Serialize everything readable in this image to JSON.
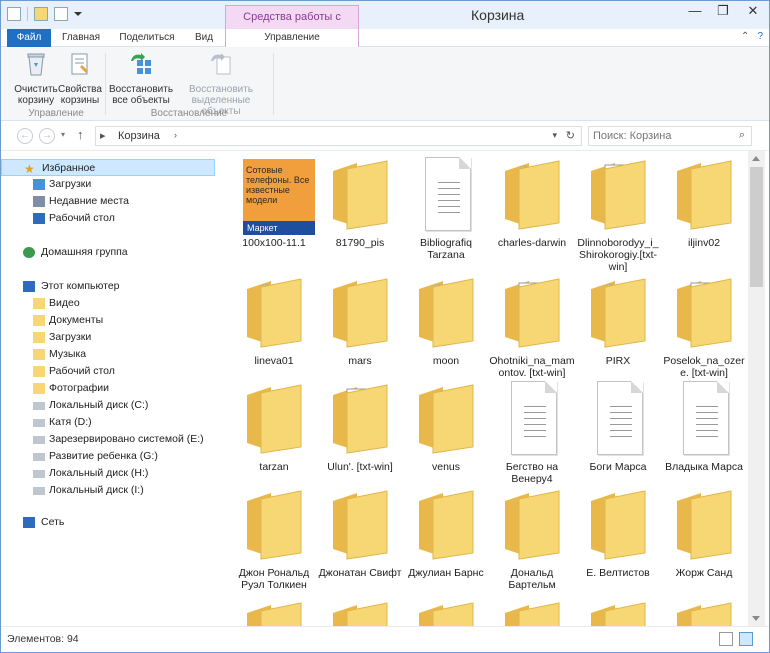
{
  "window": {
    "title": "Корзина",
    "context_tab_group": "Средства работы с корзиной",
    "controls": {
      "minimize": "—",
      "maximize": "❐",
      "close": "✕"
    }
  },
  "tabs": {
    "file": "Файл",
    "home": "Главная",
    "share": "Поделиться",
    "view": "Вид",
    "manage": "Управление"
  },
  "ribbon": {
    "empty_bin": "Очистить корзину",
    "bin_props": "Свойства корзины",
    "group_manage": "Управление",
    "restore_all": "Восстановить все объекты",
    "restore_selected": "Восстановить выделенные объекты",
    "group_restore": "Восстановление"
  },
  "address": {
    "path": "Корзина",
    "search_placeholder": "Поиск: Корзина"
  },
  "nav": {
    "favorites": "Избранное",
    "fav_items": [
      "Загрузки",
      "Недавние места",
      "Рабочий стол"
    ],
    "homegroup": "Домашняя группа",
    "computer": "Этот компьютер",
    "comp_items": [
      "Видео",
      "Документы",
      "Загрузки",
      "Музыка",
      "Рабочий стол",
      "Фотографии",
      "Локальный диск (C:)",
      "Катя (D:)",
      "Зарезервировано системой (E:)",
      "Развитие ребенка (G:)",
      "Локальный диск (H:)",
      "Локальный диск (I:)"
    ],
    "network": "Сеть"
  },
  "items": [
    "100x100-11.1",
    "81790_pis",
    "Bibliografiq Tarzana",
    "charles-darwin",
    "Dlinnoborodyy_i_Shirokorogiy.[txt-win]",
    "iljinv02",
    "lineva01",
    "mars",
    "moon",
    "Ohotniki_na_mamontov. [txt-win]",
    "PIRX",
    "Poselok_na_ozere. [txt-win]",
    "tarzan",
    "Ulun'. [txt-win]",
    "venus",
    "Бегство на Венеру4",
    "Боги Марса",
    "Владыка Марса",
    "Джон Рональд Руэл Толкиен",
    "Джонатан Свифт",
    "Джулиан Барнс",
    "Дональд Бартельм",
    "Е. Велтистов",
    "Жорж Санд"
  ],
  "thumbnail_ad": {
    "text": "Сотовые телефоны. Все известные модели",
    "brand": "Маркет"
  },
  "status": {
    "count": "Элементов: 94"
  },
  "icons": {
    "favorites": "star-icon",
    "homegroup": "homegroup-icon",
    "computer": "computer-icon",
    "network": "network-icon",
    "folder": "folder-icon",
    "document": "document-icon"
  },
  "colors": {
    "accent": "#1f6fc4",
    "context": "#f3d9f4",
    "folder": "#f7d774",
    "selection": "#cde8ff"
  }
}
